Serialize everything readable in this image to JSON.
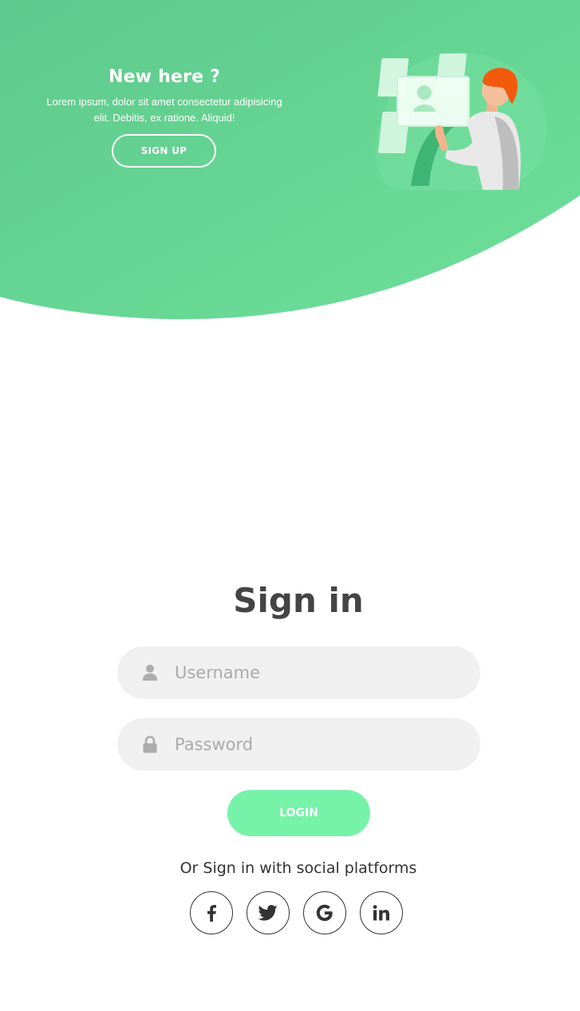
{
  "panel": {
    "title": "New here ?",
    "description": "Lorem ipsum, dolor sit amet consectetur adipisicing elit. Debitis, ex ratione. Aliquid!",
    "signup_label": "SIGN UP",
    "illustration_icon": "person-touching-screen-illustration"
  },
  "signin": {
    "title": "Sign in",
    "username": {
      "placeholder": "Username",
      "value": "",
      "icon": "user-icon"
    },
    "password": {
      "placeholder": "Password",
      "value": "",
      "icon": "lock-icon"
    },
    "login_label": "LOGIN",
    "social_text": "Or Sign in with social platforms",
    "social": [
      {
        "name": "facebook",
        "glyph": "f",
        "icon": "facebook-icon"
      },
      {
        "name": "twitter",
        "glyph": "",
        "icon": "twitter-icon"
      },
      {
        "name": "google",
        "glyph": "G",
        "icon": "google-icon"
      },
      {
        "name": "linkedin",
        "glyph": "in",
        "icon": "linkedin-icon"
      }
    ]
  },
  "colors": {
    "primary_green_start": "#5ec98c",
    "primary_green_end": "#6ee09a",
    "login_button": "#77f2a9",
    "input_bg": "#f0f0f0",
    "title_text": "#444444",
    "placeholder": "#aaaaaa"
  }
}
